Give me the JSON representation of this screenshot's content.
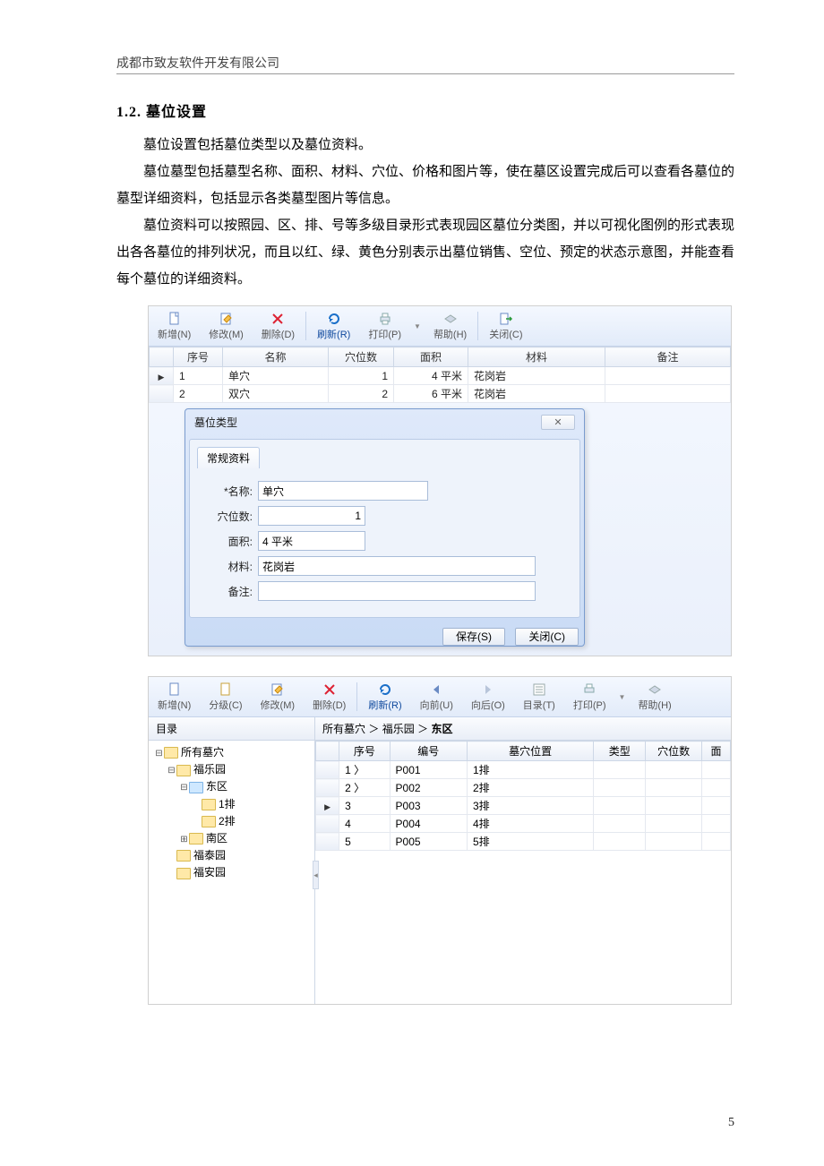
{
  "doc": {
    "company": "成都市致友软件开发有限公司",
    "section_no": "1.2.",
    "section_title": "墓位设置",
    "p1": "墓位设置包括墓位类型以及墓位资料。",
    "p2": "墓位墓型包括墓型名称、面积、材料、穴位、价格和图片等，使在墓区设置完成后可以查看各墓位的墓型详细资料，包括显示各类墓型图片等信息。",
    "p3": "墓位资料可以按照园、区、排、号等多级目录形式表现园区墓位分类图，并以可视化图例的形式表现出各各墓位的排列状况，而且以红、绿、黄色分别表示出墓位销售、空位、预定的状态示意图，并能查看每个墓位的详细资料。",
    "page_number": "5"
  },
  "s1": {
    "toolbar": {
      "new": "新增(N)",
      "edit": "修改(M)",
      "delete": "删除(D)",
      "refresh": "刷新(R)",
      "print": "打印(P)",
      "help": "帮助(H)",
      "close": "关闭(C)"
    },
    "cols": {
      "seq": "序号",
      "name": "名称",
      "holes": "穴位数",
      "area": "面积",
      "material": "材料",
      "remark": "备注"
    },
    "rows": [
      {
        "seq": "1",
        "name": "单穴",
        "holes": "1",
        "area": "4 平米",
        "material": "花岗岩",
        "remark": ""
      },
      {
        "seq": "2",
        "name": "双穴",
        "holes": "2",
        "area": "6 平米",
        "material": "花岗岩",
        "remark": ""
      }
    ],
    "dialog": {
      "title": "墓位类型",
      "tab": "常规资料",
      "labels": {
        "name": "*名称:",
        "holes": "穴位数:",
        "area": "面积:",
        "material": "材料:",
        "remark": "备注:"
      },
      "values": {
        "name": "单穴",
        "holes": "1",
        "area": "4 平米",
        "material": "花岗岩",
        "remark": ""
      },
      "save": "保存(S)",
      "close": "关闭(C)",
      "x": "✕"
    }
  },
  "s2": {
    "toolbar": {
      "new": "新增(N)",
      "level": "分级(C)",
      "edit": "修改(M)",
      "delete": "删除(D)",
      "refresh": "刷新(R)",
      "prev": "向前(U)",
      "next": "向后(O)",
      "toc": "目录(T)",
      "print": "打印(P)",
      "help": "帮助(H)"
    },
    "tree": {
      "title": "目录",
      "root": "所有墓穴",
      "n1": "福乐园",
      "n1a": "东区",
      "n1a1": "1排",
      "n1a2": "2排",
      "n1b": "南区",
      "n2": "福泰园",
      "n3": "福安园"
    },
    "breadcrumb": {
      "a": "所有墓穴",
      "b": "福乐园",
      "c": "东区",
      "sep": "＞"
    },
    "cols": {
      "seq": "序号",
      "code": "编号",
      "pos": "墓穴位置",
      "type": "类型",
      "holes": "穴位数",
      "more": "面"
    },
    "rows": [
      {
        "seq": "1 〉",
        "code": "P001",
        "pos": "1排"
      },
      {
        "seq": "2 〉",
        "code": "P002",
        "pos": "2排"
      },
      {
        "seq": "3",
        "code": "P003",
        "pos": "3排",
        "current": true
      },
      {
        "seq": "4",
        "code": "P004",
        "pos": "4排"
      },
      {
        "seq": "5",
        "code": "P005",
        "pos": "5排"
      }
    ]
  }
}
